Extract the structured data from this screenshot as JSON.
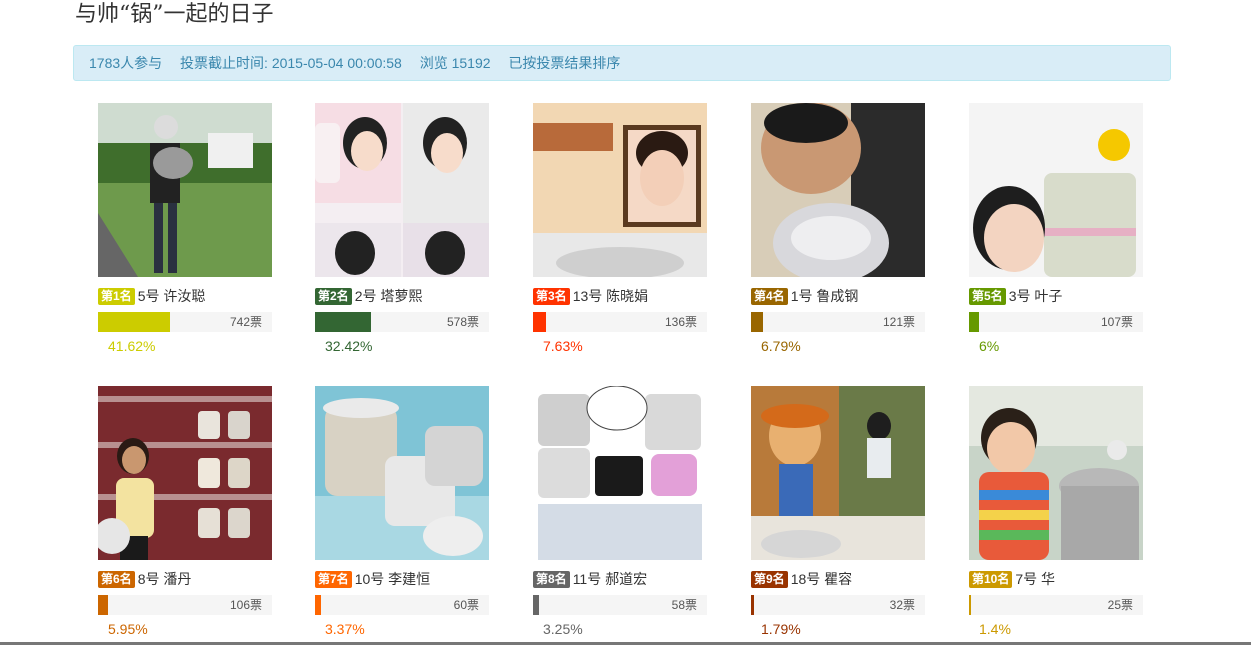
{
  "page": {
    "title": "与帅“锅”一起的日子"
  },
  "info": {
    "participants": "1783人参与",
    "deadline": "投票截止时间: 2015-05-04 00:00:58",
    "views": "浏览 15192",
    "sort_note": "已按投票结果排序"
  },
  "candidates": [
    {
      "rank": "第1名",
      "number": "5号",
      "name": "许汝聪",
      "votes": "742票",
      "percent": "41.62%",
      "share": 0.4162,
      "color": "#cccc00"
    },
    {
      "rank": "第2名",
      "number": "2号",
      "name": "塔萝熙",
      "votes": "578票",
      "percent": "32.42%",
      "share": 0.3242,
      "color": "#336633"
    },
    {
      "rank": "第3名",
      "number": "13号",
      "name": "陈晓娟",
      "votes": "136票",
      "percent": "7.63%",
      "share": 0.0763,
      "color": "#ff3300"
    },
    {
      "rank": "第4名",
      "number": "1号",
      "name": "鲁成钢",
      "votes": "121票",
      "percent": "6.79%",
      "share": 0.0679,
      "color": "#996600"
    },
    {
      "rank": "第5名",
      "number": "3号",
      "name": "叶子",
      "votes": "107票",
      "percent": "6%",
      "share": 0.06,
      "color": "#669900"
    },
    {
      "rank": "第6名",
      "number": "8号",
      "name": "潘丹",
      "votes": "106票",
      "percent": "5.95%",
      "share": 0.0595,
      "color": "#cc6600"
    },
    {
      "rank": "第7名",
      "number": "10号",
      "name": "李建恒",
      "votes": "60票",
      "percent": "3.37%",
      "share": 0.0337,
      "color": "#ff6600"
    },
    {
      "rank": "第8名",
      "number": "11号",
      "name": "郝道宏",
      "votes": "58票",
      "percent": "3.25%",
      "share": 0.0325,
      "color": "#666666"
    },
    {
      "rank": "第9名",
      "number": "18号",
      "name": "瞿容",
      "votes": "32票",
      "percent": "1.79%",
      "share": 0.0179,
      "color": "#993300"
    },
    {
      "rank": "第10名",
      "number": "7号",
      "name": "华",
      "votes": "25票",
      "percent": "1.4%",
      "share": 0.014,
      "color": "#cc9900"
    }
  ]
}
